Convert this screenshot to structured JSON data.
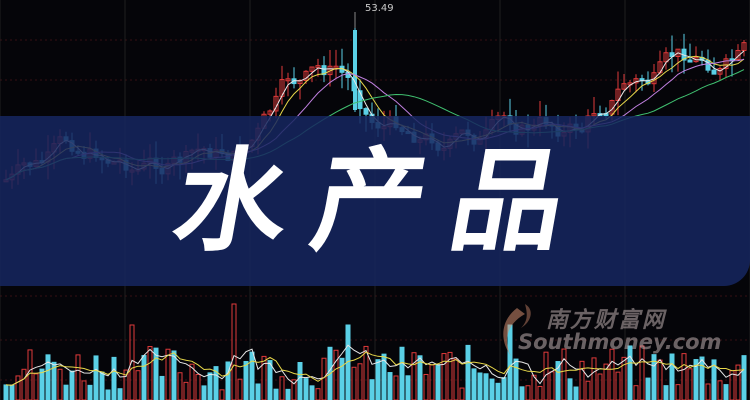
{
  "title": "水产品",
  "peak_label": "53.49",
  "watermark": {
    "cn": "南方财富网",
    "en": "Southmoney.com"
  },
  "colors": {
    "background": "#050509",
    "banner": "#162660",
    "candle_up": "#e03a3a",
    "candle_down": "#5ad0e6",
    "ma_white": "#e8e8e8",
    "ma_yellow": "#e8d84a",
    "ma_purple": "#c080e0",
    "ma_green": "#40c070",
    "grid": "#5a1818"
  },
  "icons": [
    "watermark-logo-icon"
  ]
}
